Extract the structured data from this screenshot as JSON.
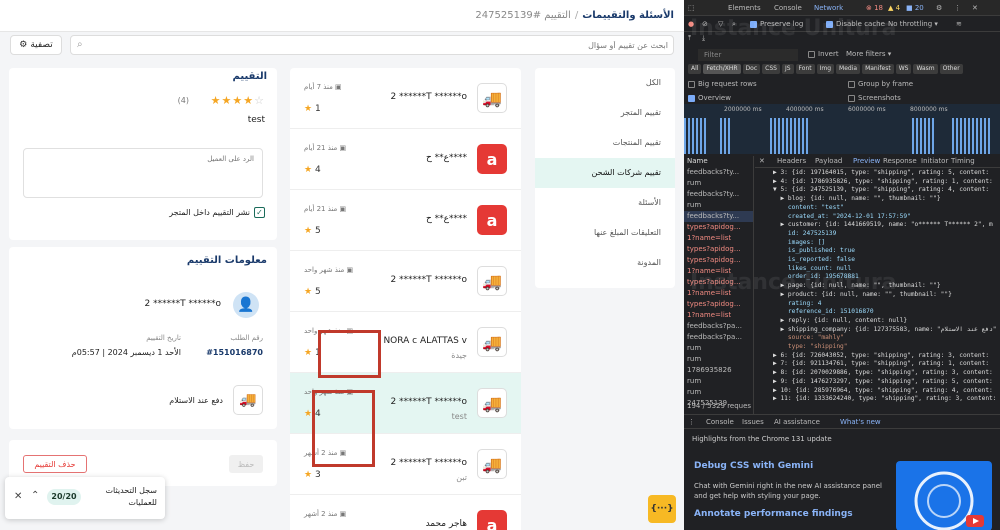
{
  "app": {
    "breadcrumb": {
      "section": "الأسئلة والتقييمات",
      "separator": "/",
      "current": "التقييم #247525139"
    },
    "filter_label": "تصفية",
    "search_placeholder": "ابحث عن تقييم أو سؤال",
    "categories": [
      {
        "label": "الكل",
        "active": false
      },
      {
        "label": "تقييم المتجر",
        "active": false
      },
      {
        "label": "تقييم المنتجات",
        "active": false
      },
      {
        "label": "تقييم شركات الشحن",
        "active": true
      },
      {
        "label": "الأسئلة",
        "active": false
      },
      {
        "label": "التعليقات المبلغ عنها",
        "active": false
      },
      {
        "label": "المدونة",
        "active": false
      }
    ],
    "reviews": [
      {
        "name": "2 ******T ******o",
        "sub": "",
        "date": "منذ 7 أيام",
        "rating": "1",
        "logo": "truck"
      },
      {
        "name": "ع** ح****",
        "sub": "",
        "date": "منذ 21 أيام",
        "rating": "4",
        "logo": "red"
      },
      {
        "name": "ع** ح****",
        "sub": "",
        "date": "منذ 21 أيام",
        "rating": "5",
        "logo": "red"
      },
      {
        "name": "2 ******T ******o",
        "sub": "",
        "date": "منذ شهر واحد",
        "rating": "5",
        "logo": "truck"
      },
      {
        "name": "NORA c ALATTAS v",
        "sub": "جيدة",
        "date": "منذ شهر واحد",
        "rating": "1",
        "logo": "truck"
      },
      {
        "name": "2 ******T ******o",
        "sub": "test",
        "date": "منذ شهر واحد",
        "rating": "4",
        "logo": "truck"
      },
      {
        "name": "2 ******T ******o",
        "sub": "تبن",
        "date": "منذ 2 أشهر",
        "rating": "3",
        "logo": "truck"
      },
      {
        "name": "هاجر محمد",
        "sub": "",
        "date": "منذ 2 أشهر",
        "rating": "",
        "logo": "red"
      }
    ],
    "review_card": {
      "title": "التقييم",
      "count": "(4)",
      "rating": 4,
      "content": "test",
      "reply_placeholder": "الرد على العميل",
      "publish_label": "نشر التقييم داخل المتجر"
    },
    "info_card": {
      "title": "معلومات التقييم",
      "customer": "2 ******T ******o",
      "order_label": "رقم الطلب",
      "order_value": "#151016870",
      "date_label": "تاريخ التقييم",
      "date_value": "الأحد 1 ديسمبر 2024 | 05:57م",
      "payment": "دفع عند الاستلام"
    },
    "actions": {
      "delete_label": "حذف التقييم",
      "save_label": "حفظ"
    },
    "toast": {
      "text": "سجل التحديثات للعمليات",
      "badge": "20/20"
    },
    "fab_label": "{···}"
  },
  "devtools": {
    "tabs": [
      "Elements",
      "Console",
      "Network"
    ],
    "errors": "18",
    "warnings": "4",
    "infos": "20",
    "preserve_log": "Preserve log",
    "disable_cache": "Disable cache",
    "throttling": "No throttling",
    "filter_placeholder": "Filter",
    "invert": "Invert",
    "more_filters": "More filters",
    "types": [
      "All",
      "Fetch/XHR",
      "Doc",
      "CSS",
      "JS",
      "Font",
      "Img",
      "Media",
      "Manifest",
      "WS",
      "Wasm",
      "Other"
    ],
    "big_request_rows": "Big request rows",
    "group_by_frame": "Group by frame",
    "overview": "Overview",
    "screenshots": "Screenshots",
    "timeline_ticks": [
      "2000000 ms",
      "4000000 ms",
      "6000000 ms",
      "8000000 ms"
    ],
    "name_header": "Name",
    "requests": [
      {
        "name": "feedbacks?ty...",
        "err": false,
        "hl": false
      },
      {
        "name": "rum",
        "err": false,
        "hl": false
      },
      {
        "name": "feedbacks?ty...",
        "err": false,
        "hl": false
      },
      {
        "name": "rum",
        "err": false,
        "hl": false
      },
      {
        "name": "feedbacks?ty...",
        "err": false,
        "hl": true
      },
      {
        "name": "types?apidog...",
        "err": true,
        "hl": false
      },
      {
        "name": "1?name=list",
        "err": true,
        "hl": false
      },
      {
        "name": "types?apidog...",
        "err": true,
        "hl": false
      },
      {
        "name": "types?apidog...",
        "err": true,
        "hl": false
      },
      {
        "name": "1?name=list",
        "err": true,
        "hl": false
      },
      {
        "name": "types?apidog...",
        "err": true,
        "hl": false
      },
      {
        "name": "1?name=list",
        "err": true,
        "hl": false
      },
      {
        "name": "types?apidog...",
        "err": true,
        "hl": false
      },
      {
        "name": "1?name=list",
        "err": true,
        "hl": false
      },
      {
        "name": "feedbacks?pa...",
        "err": false,
        "hl": false
      },
      {
        "name": "feedbacks?pa...",
        "err": false,
        "hl": false
      },
      {
        "name": "rum",
        "err": false,
        "hl": false
      },
      {
        "name": "rum",
        "err": false,
        "hl": false
      },
      {
        "name": "1786935826",
        "err": false,
        "hl": false
      },
      {
        "name": "rum",
        "err": false,
        "hl": false
      },
      {
        "name": "rum",
        "err": false,
        "hl": false
      },
      {
        "name": "247525139",
        "err": false,
        "hl": false
      }
    ],
    "requests_status": "194 / 5329 reques",
    "detail_tabs": [
      "Headers",
      "Payload",
      "Preview",
      "Response",
      "Initiator",
      "Timing"
    ],
    "preview_lines": [
      "▶ 3: {id: 197164015, type: \"shipping\", rating: 5, content: ",
      "▶ 4: {id: 1786935826, type: \"shipping\", rating: 1, content: ",
      "▼ 5: {id: 247525139, type: \"shipping\", rating: 4, content: ",
      "  ▶ blog: {id: null, name: \"\", thumbnail: \"\"}",
      "    content: \"test\"",
      "    created_at: \"2024-12-01 17:57:59\"",
      "  ▶ customer: {id: 1441669519, name: \"o****** T****** 2\", m",
      "    id: 247525139",
      "    images: []",
      "    is_published: true",
      "    is_reported: false",
      "    likes_count: null",
      "    order_id: 195678881",
      "  ▶ page: {id: null, name: \"\", thumbnail: \"\"}",
      "  ▶ product: {id: null, name: \"\", thumbnail: \"\"}",
      "    rating: 4",
      "    reference_id: 151016870",
      "  ▶ reply: {id: null, content: null}",
      "  ▶ shipping_company: {id: 127375583, name: \"دفع عند الاستلام\"",
      "    source: \"mahly\"",
      "    type: \"shipping\"",
      "▶ 6: {id: 726043052, type: \"shipping\", rating: 3, content: ",
      "▶ 7: {id: 921134761, type: \"shipping\", rating: 1, content: ",
      "▶ 8: {id: 2070029886, type: \"shipping\", rating: 3, content: ",
      "▶ 9: {id: 1476273297, type: \"shipping\", rating: 5, content: ",
      "▶ 10: {id: 285976964, type: \"shipping\", rating: 4, content: ",
      "▶ 11: {id: 1333624240, type: \"shipping\", rating: 3, content: "
    ],
    "drawer_tabs": [
      "Console",
      "Issues",
      "AI assistance",
      "What's new"
    ],
    "drawer_header": "Highlights from the Chrome 131 update",
    "drawer_title1": "Debug CSS with Gemini",
    "drawer_text": "Chat with Gemini right in the new AI assistance panel and get help with styling your page.",
    "drawer_title2": "Annotate performance findings",
    "watermark": "Instance Unitura"
  }
}
